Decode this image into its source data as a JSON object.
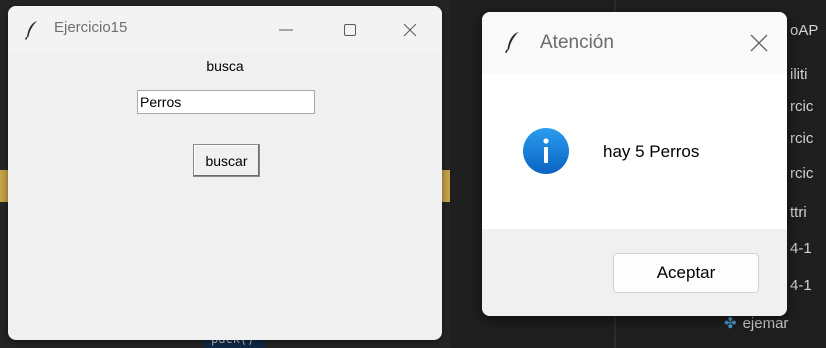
{
  "background": {
    "code_snippet": "pack()",
    "file_fragments": [
      "oAP",
      "iliti",
      "rcic",
      "rcic",
      "rcic",
      "ttri",
      "4-1",
      "4-1"
    ],
    "bottom_file": "ejemar"
  },
  "main_window": {
    "title": "Ejercicio15",
    "label": "busca",
    "entry_value": "Perros",
    "button_label": "buscar"
  },
  "dialog": {
    "title": "Atención",
    "message": "hay 5 Perros",
    "ok_label": "Aceptar"
  },
  "colors": {
    "info_blue": "#1a7fd8",
    "window_bg": "#f0f0f0"
  }
}
